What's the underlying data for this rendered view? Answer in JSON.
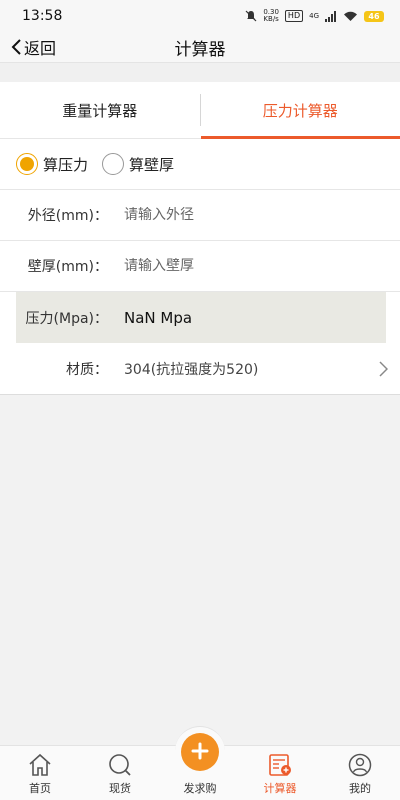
{
  "status_bar": {
    "time": "13:58",
    "net_speed_value": "0.30",
    "net_speed_unit": "KB/s",
    "hd_badge": "HD",
    "signal_label": "4G",
    "battery": "46"
  },
  "header": {
    "back_label": "返回",
    "title": "计算器"
  },
  "tabs": [
    {
      "label": "重量计算器",
      "active": false
    },
    {
      "label": "压力计算器",
      "active": true
    }
  ],
  "mode_options": [
    {
      "label": "算压力",
      "checked": true
    },
    {
      "label": "算壁厚",
      "checked": false
    }
  ],
  "form": {
    "outer_diameter_label": "外径(mm)：",
    "outer_diameter_placeholder": "请输入外径",
    "wall_thickness_label": "壁厚(mm)：",
    "wall_thickness_placeholder": "请输入壁厚",
    "pressure_label": "压力(Mpa)：",
    "pressure_value": "NaN Mpa",
    "material_label": "材质：",
    "material_value": "304(抗拉强度为520)"
  },
  "bottom_nav": [
    {
      "label": "首页",
      "icon": "home-icon",
      "active": false
    },
    {
      "label": "现货",
      "icon": "search-icon",
      "active": false
    },
    {
      "label": "发求购",
      "icon": "plus-icon",
      "active": false
    },
    {
      "label": "计算器",
      "icon": "calculator-icon",
      "active": true
    },
    {
      "label": "我的",
      "icon": "user-icon",
      "active": false
    }
  ],
  "colors": {
    "accent": "#ec5a2b",
    "radio_checked": "#f0a400",
    "publish_button": "#f39022"
  }
}
